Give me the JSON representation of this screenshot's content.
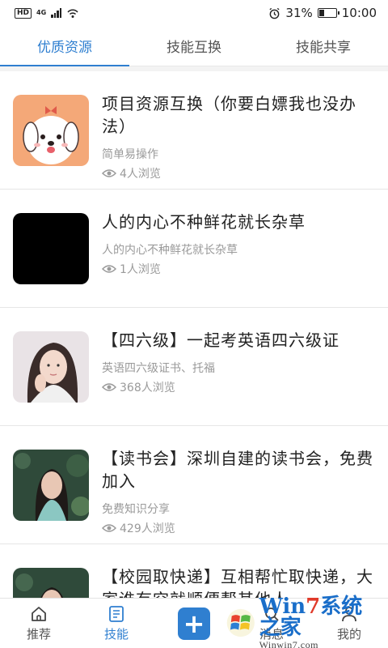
{
  "status": {
    "hd": "HD",
    "network": "4G",
    "battery_pct": "31%",
    "battery_level": 0.31,
    "time": "10:00"
  },
  "tabs": [
    {
      "label": "优质资源",
      "active": true
    },
    {
      "label": "技能互换",
      "active": false
    },
    {
      "label": "技能共享",
      "active": false
    }
  ],
  "items": [
    {
      "title": "项目资源互换（你要白嫖我也没办法）",
      "desc": "简单易操作",
      "views": "4人浏览",
      "thumb": "cartoon-dog"
    },
    {
      "title": "人的内心不种鲜花就长杂草",
      "desc": "人的内心不种鲜花就长杂草",
      "views": "1人浏览",
      "thumb": "black"
    },
    {
      "title": "【四六级】一起考英语四六级证",
      "desc": "英语四六级证书、托福",
      "views": "368人浏览",
      "thumb": "woman-portrait"
    },
    {
      "title": "【读书会】深圳自建的读书会，免费加入",
      "desc": "免费知识分享",
      "views": "429人浏览",
      "thumb": "woman-greenery"
    },
    {
      "title": "【校园取快递】互相帮忙取快递，大家谁有空就顺便帮其他人",
      "desc": "",
      "views": "",
      "thumb": "woman-greenery"
    }
  ],
  "nav": [
    {
      "label": "推荐",
      "icon": "home-icon",
      "active": false
    },
    {
      "label": "技能",
      "icon": "skill-icon",
      "active": true
    },
    {
      "label": "",
      "icon": "plus-icon",
      "active": false
    },
    {
      "label": "消息",
      "icon": "search-icon",
      "active": false
    },
    {
      "label": "我的",
      "icon": "user-icon",
      "active": false
    }
  ],
  "watermark": {
    "brand_a": "Win",
    "brand_b": "7",
    "brand_c": "系统之家",
    "url": "Winwin7.com"
  },
  "colors": {
    "accent": "#2f7fd0",
    "text": "#222222",
    "muted": "#9a9a9a"
  }
}
